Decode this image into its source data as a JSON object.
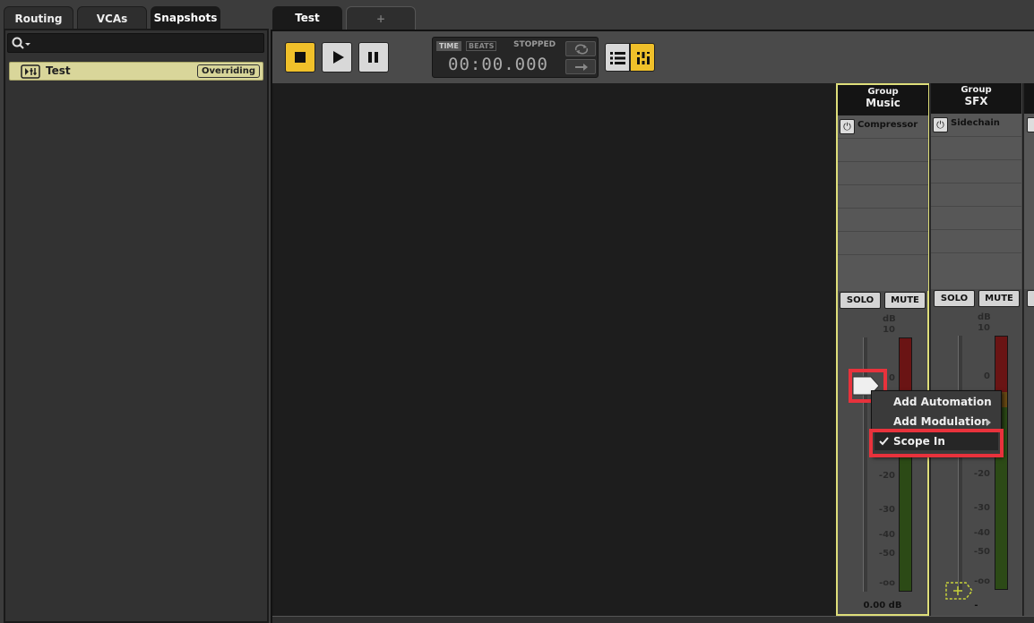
{
  "left_tabs": [
    {
      "label": "Routing"
    },
    {
      "label": "VCAs"
    },
    {
      "label": "Snapshots"
    }
  ],
  "snapshots": {
    "items": [
      {
        "name": "Test",
        "badge": "Overriding"
      }
    ]
  },
  "doc_tabs": [
    {
      "label": "Test"
    },
    {
      "label": "+"
    }
  ],
  "transport": {
    "time_label": "TIME",
    "beats_label": "BEATS",
    "state": "STOPPED",
    "time": "00:00.000"
  },
  "strips": [
    {
      "type": "Group",
      "name": "Music",
      "effects": [
        {
          "name": "Compressor"
        }
      ],
      "solo": "SOLO",
      "mute": "MUTE",
      "db_label": "dB",
      "scale": [
        "10",
        "0",
        "-20",
        "-30",
        "-40",
        "-50",
        "-oo"
      ],
      "level": "0.00 dB"
    },
    {
      "type": "Group",
      "name": "SFX",
      "effects": [
        {
          "name": "Sidechain"
        }
      ],
      "solo": "SOLO",
      "mute": "MUTE",
      "db_label": "dB",
      "scale": [
        "10",
        "0",
        "-20",
        "-30",
        "-40",
        "-50",
        "-oo"
      ],
      "level": "-"
    }
  ],
  "context_menu": {
    "items": [
      {
        "label": "Add Automation"
      },
      {
        "label": "Add Modulation"
      },
      {
        "label": "Scope In",
        "checked": true
      }
    ]
  },
  "colors": {
    "accent_yellow": "#f0c02a",
    "selection_outline": "#dede7a",
    "highlight_red": "#e8323c",
    "snapshot_bg": "#d9d69a"
  }
}
